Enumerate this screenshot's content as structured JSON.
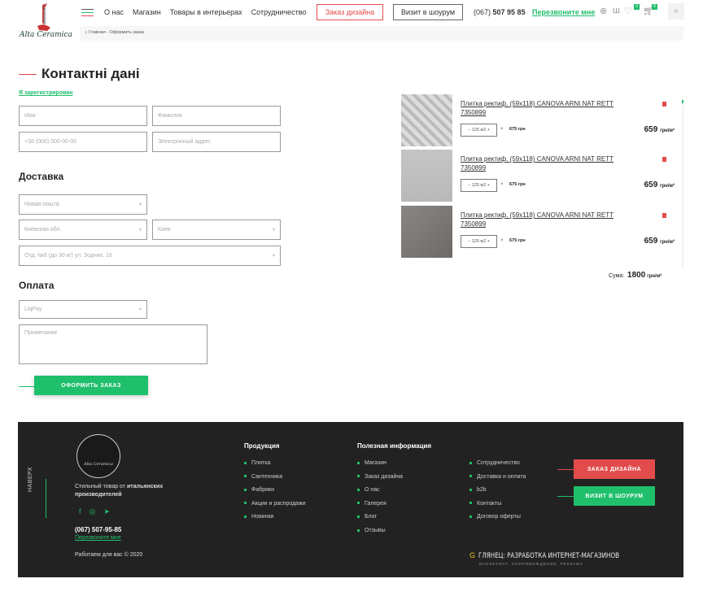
{
  "header": {
    "logo_text": "Alta Ceramica",
    "nav": [
      "О нас",
      "Магазин",
      "Товары в интерьерах",
      "Сотрудничество"
    ],
    "design_button": "Заказ дизайна",
    "showroom_button": "Визит в шоурум",
    "phone_prefix": "(067)",
    "phone_number": "507 95 85",
    "callback": "Перезвоните мне",
    "wishlist_count": "2",
    "cart_count": "5",
    "accent": "#1fbf6b",
    "red": "#e24b4b"
  },
  "breadcrumb": "Главная - Оформить заказ",
  "form": {
    "title": "Контактні дані",
    "registered_link": "Я зарегистрирован",
    "name_placeholder": "Имя",
    "surname_placeholder": "Фамилия",
    "phone_placeholder": "+38 (000) 000-00-00",
    "email_placeholder": "Электронный адрес",
    "delivery_title": "Доставка",
    "delivery_method": "Новая пошта",
    "region": "Киевская обл.",
    "city": "Киев",
    "branch": "Отд. №6 (до 30 кг) ул. Зодчих, 16",
    "payment_title": "Оплата",
    "payment_method": "LiqPay",
    "note_placeholder": "Примечание",
    "submit": "ОФОРМИТЬ ЗАКАЗ"
  },
  "cart": {
    "items": [
      {
        "title": "Плитка ректиф. (59x118) CANOVA ARNI NAT RETT 7350899",
        "qty": "− 125 м2 +",
        "times": "×",
        "unit_price": "675 грн",
        "price": "659",
        "price_unit": "грн/м²"
      },
      {
        "title": "Плитка ректиф. (59x118) CANOVA ARNI NAT RETT 7350899",
        "qty": "− 125 м2 +",
        "times": "×",
        "unit_price": "675 грн",
        "price": "659",
        "price_unit": "грн/м²"
      },
      {
        "title": "Плитка ректиф. (59x118) CANOVA ARNI NAT RETT 7350899",
        "qty": "− 125 м2 +",
        "times": "×",
        "unit_price": "675 грн",
        "price": "659",
        "price_unit": "грн/м²"
      }
    ],
    "sum_label": "Сума:",
    "sum_value": "1800",
    "sum_unit": "грн/м²"
  },
  "footer": {
    "logo_text": "Alta Ceramica",
    "to_top": "НАВЕРХ",
    "tagline_1": "Стильный товар от ",
    "tagline_bold": "итальянских производителей",
    "phone": "(067) 507-95-85",
    "callback": "Перезвоните мне",
    "copyright": "Работаем для вас © 2020",
    "products_title": "Продукция",
    "products": [
      "Плитка",
      "Сантехника",
      "Фабрики",
      "Акции и распродажи",
      "Новинки"
    ],
    "info_title": "Полезная информация",
    "info_col1": [
      "Магазин",
      "Заказ дизайна",
      "О нас",
      "Галерея",
      "Блог",
      "Отзывы"
    ],
    "info_col2": [
      "Сотрудничество",
      "Доставка и оплата",
      "b2b",
      "Контакты",
      "Договор оферты"
    ],
    "design_button": "ЗАКАЗ ДИЗАЙНА",
    "showroom_button": "ВИЗИТ В ШОУРУМ",
    "dev_title": "ГЛЯНЕЦ: РАЗРАБОТКА ИНТЕРНЕТ-МАГАЗИНОВ",
    "dev_sub": "МАРКЕТИНГ, СОПРОВОЖДЕНИЕ, РЕКЛАМА"
  }
}
